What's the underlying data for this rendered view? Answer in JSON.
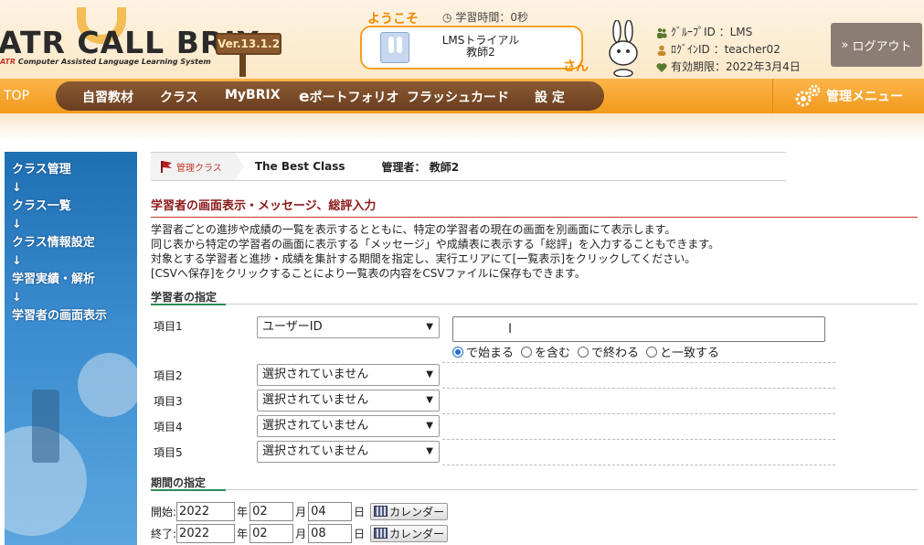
{
  "header": {
    "logo_title": "ATR CALL BRIX",
    "logo_subtitle_prefix": "ATR",
    "logo_subtitle_rest": " Computer Assisted Language Learning System",
    "version": "Ver.13.1.2",
    "welcome_label": "ようこそ",
    "study_time": "学習時間：0秒",
    "welcome_name": "LMSトライアル",
    "welcome_role": "教師2",
    "san_label": "さん",
    "group_id": "ｸﾞﾙｰﾌﾟID ：LMS",
    "login_id": "ﾛｸﾞｲﾝID ：teacher02",
    "expiry": "有効期限：2022年3月4日",
    "logout_label": "ログアウト"
  },
  "nav": {
    "top": "TOP",
    "items": [
      "自習教材",
      "クラス",
      "MyBRIX",
      "ポートフォリオ",
      "フラッシュカード",
      "設 定"
    ],
    "portfolio_prefix": "e",
    "admin_menu": "管理メニュー"
  },
  "sidebar": {
    "items": [
      "クラス管理",
      "↓",
      "クラス一覧",
      "↓",
      "クラス情報設定",
      "↓",
      "学習実績・解析",
      "↓",
      "学習者の画面表示"
    ]
  },
  "breadcrumb": {
    "first": "管理クラス",
    "class_name": "The Best Class",
    "admin": "管理者： 教師2"
  },
  "main": {
    "section_title": "学習者の画面表示・メッセージ、総評入力",
    "description": [
      "学習者ごとの進捗や成績の一覧を表示するとともに、特定の学習者の現在の画面を別画面にて表示します。",
      "同じ表から特定の学習者の画面に表示する「メッセージ」や成績表に表示する「総評」を入力することもできます。",
      "対象とする学習者と進捗・成績を集計する期間を指定し、実行エリアにて[一覧表示]をクリックしてください。",
      "[CSVへ保存]をクリックすることにより一覧表の内容をCSVファイルに保存もできます。"
    ],
    "learner_heading": "学習者の指定",
    "fields": [
      {
        "label": "項目1",
        "value": "ユーザーID"
      },
      {
        "label": "項目2",
        "value": "選択されていません"
      },
      {
        "label": "項目3",
        "value": "選択されていません"
      },
      {
        "label": "項目4",
        "value": "選択されていません"
      },
      {
        "label": "項目5",
        "value": "選択されていません"
      }
    ],
    "search_value": "",
    "match_options": [
      "で始まる",
      "を含む",
      "で終わる",
      "と一致する"
    ],
    "period_heading": "期間の指定",
    "start": {
      "label": "開始:",
      "year": "2022",
      "month": "02",
      "day": "04"
    },
    "end": {
      "label": "終了:",
      "year": "2022",
      "month": "02",
      "day": "08"
    },
    "year_unit": "年",
    "month_unit": "月",
    "day_unit": "日",
    "calendar_label": "カレンダー"
  },
  "colors": {
    "nav_orange": "#f29a1c",
    "nav_brown": "#6a3e1e",
    "sidebar_blue": "#1f6fb3",
    "title_red": "#8b1a1a",
    "logout_gray": "#8b7d74"
  }
}
